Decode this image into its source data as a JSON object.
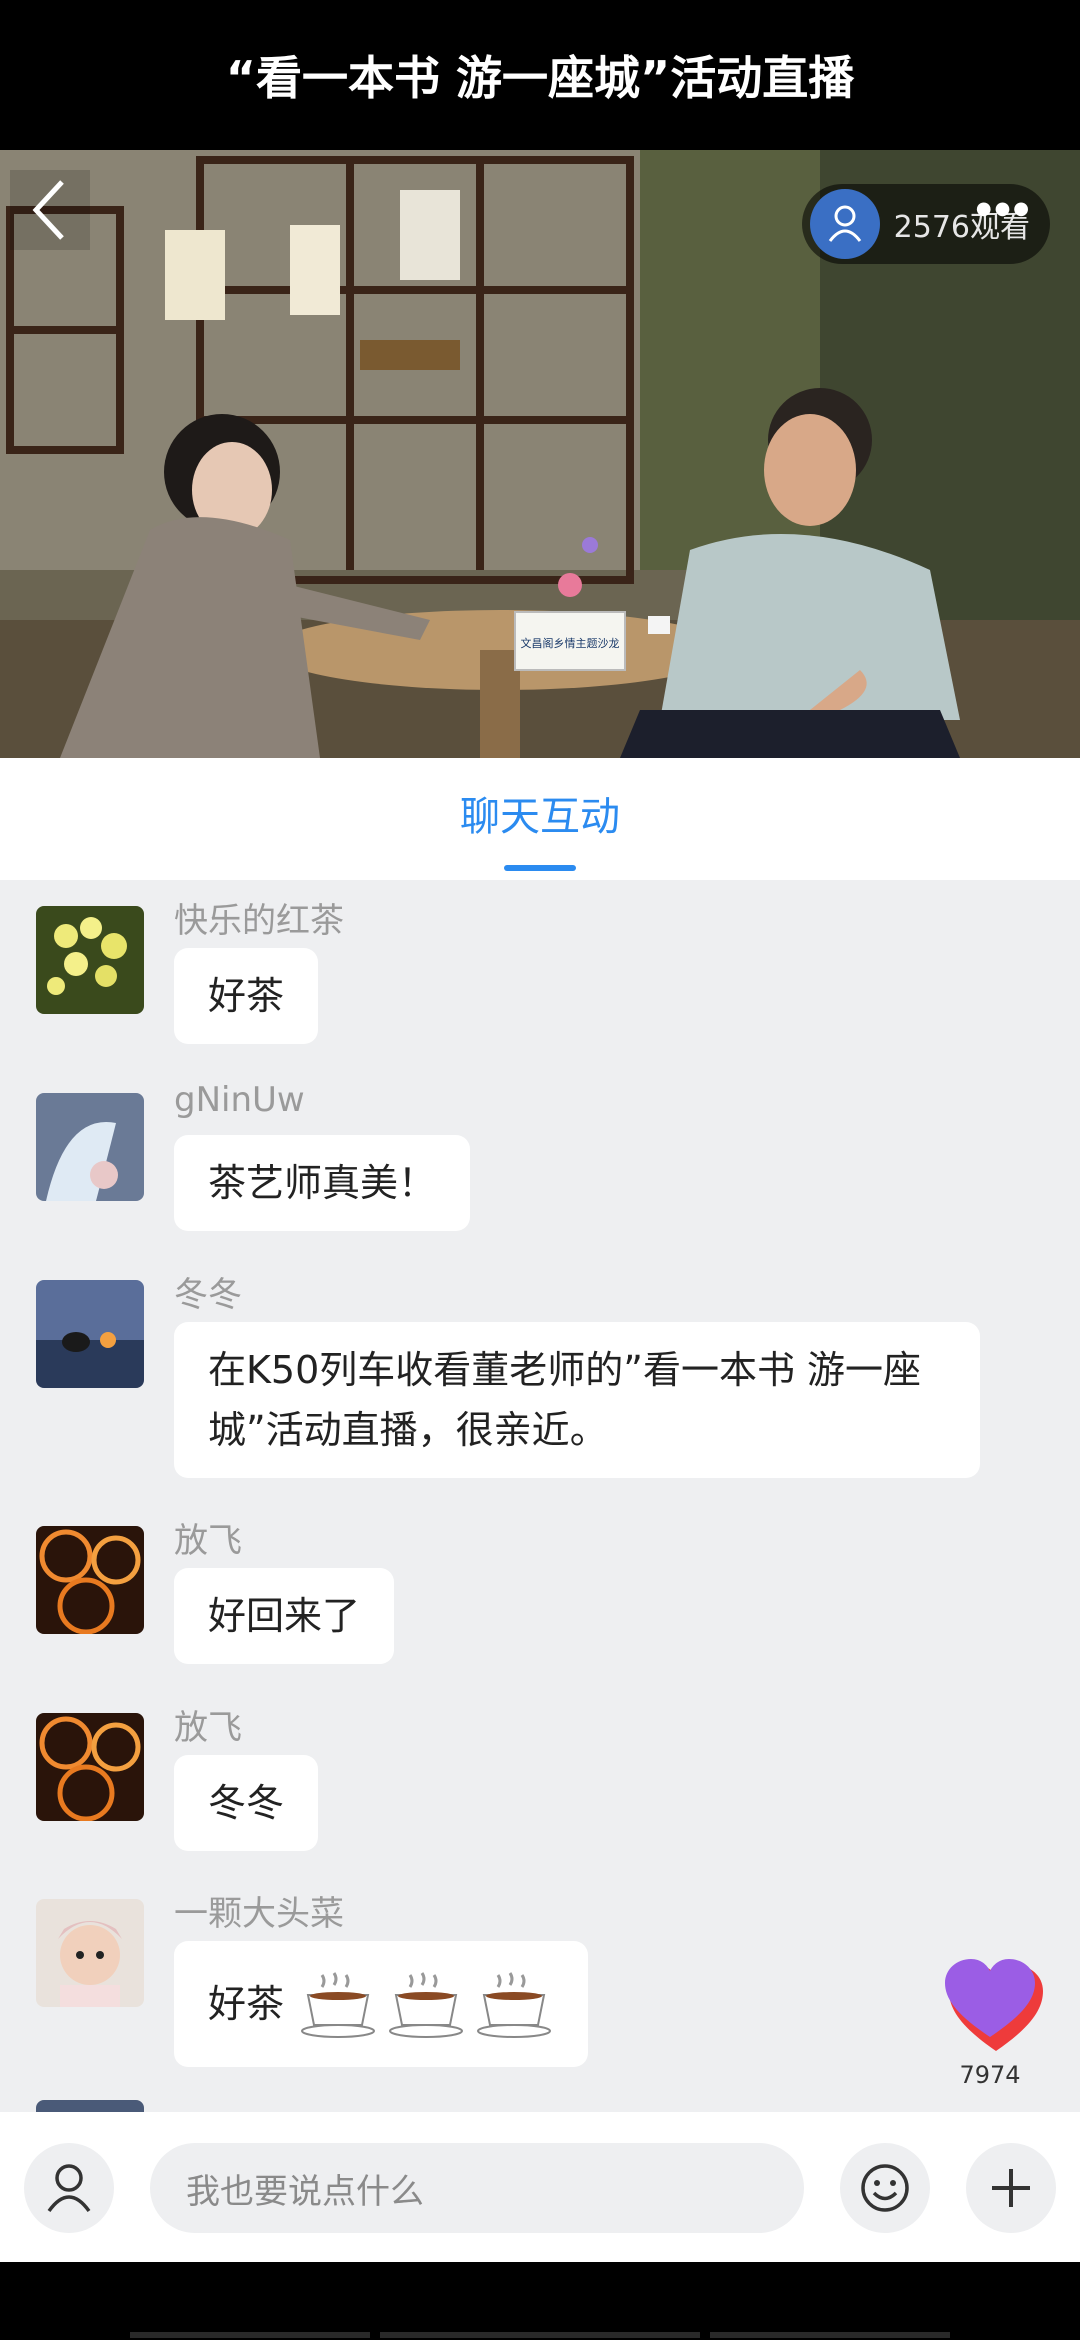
{
  "header": {
    "title": "“看一本书 游一座城”活动直播"
  },
  "video": {
    "viewer_count": "2576观看",
    "placard_text": "文昌阁乡情主题沙龙"
  },
  "tabs": [
    {
      "label": "聊天互动",
      "active": true
    }
  ],
  "messages": [
    {
      "user": "快乐的红茶",
      "text": "好茶"
    },
    {
      "user": "gNinUw",
      "text": "茶艺师真美！"
    },
    {
      "user": "冬冬",
      "text": "在K50列车收看董老师的”看一本书 游一座城”活动直播，很亲近。"
    },
    {
      "user": "放飞",
      "text": "好回来了"
    },
    {
      "user": "放飞",
      "text": "冬冬"
    },
    {
      "user": "一颗大头菜",
      "text": "好茶"
    }
  ],
  "likes": {
    "count": "7974"
  },
  "input": {
    "placeholder": "我也要说点什么"
  },
  "colors": {
    "accent": "#2b8bf0",
    "chat_bg": "#eeeff1",
    "like_heart": "#9b5de5"
  },
  "icons": [
    "back-icon",
    "user-icon",
    "more-icon",
    "heart-icon",
    "emoji-icon",
    "plus-icon",
    "tea-cup-icon"
  ]
}
